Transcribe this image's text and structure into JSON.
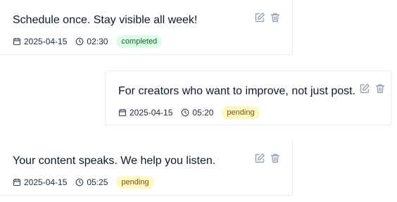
{
  "posts": [
    {
      "text": "Schedule once. Stay visible all week!",
      "date": "2025-04-15",
      "time": "02:30",
      "status": "completed"
    },
    {
      "text": "For creators who want to improve, not just post.",
      "date": "2025-04-15",
      "time": "05:20",
      "status": "pending"
    },
    {
      "text": "Your content speaks. We help you listen.",
      "date": "2025-04-15",
      "time": "05:25",
      "status": "pending"
    }
  ],
  "colors": {
    "completed_bg": "#dcfce7",
    "completed_text": "#166534",
    "pending_bg": "#fef9c3",
    "pending_text": "#854d0e",
    "icon": "#9ca3af"
  },
  "icons": {
    "edit": "edit-icon",
    "delete": "trash-icon",
    "date": "calendar-icon",
    "time": "clock-icon"
  }
}
